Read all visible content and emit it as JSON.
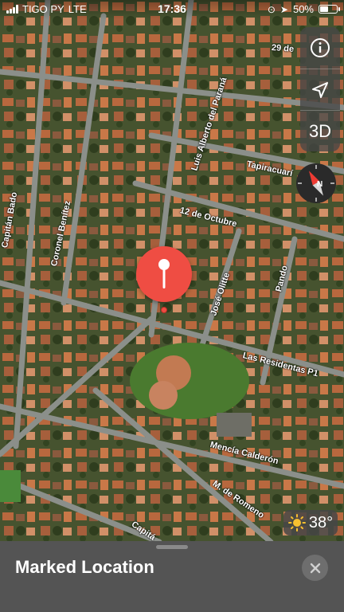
{
  "status_bar": {
    "carrier": "TIGO PY",
    "network": "LTE",
    "time": "17:36",
    "battery": "50%",
    "battery_level": 0.5
  },
  "map_controls": {
    "info_icon": "info-icon",
    "location_icon": "location-arrow-icon",
    "view_3d_label": "3D"
  },
  "streets": {
    "luis_alberto": "Luis Alberto del Paraná",
    "street_29": "29 de",
    "tapiracuai": "Tapiracuarí",
    "capitan_bado": "Capitán Bado",
    "coronel_benitez": "Coronel Benítez",
    "doce_octubre": "12 de Octubre",
    "jose_olitte": "José Olitte",
    "pando": "Pando",
    "residentas": "Las Residentas P1",
    "mencia": "Mencía Calderón",
    "romeno": "M. de Romeno",
    "capita": "Capitá"
  },
  "weather": {
    "icon": "sun-icon",
    "temperature": "38°"
  },
  "sheet": {
    "title": "Marked Location",
    "close_icon": "close-icon"
  },
  "colors": {
    "pin": "#ef4d43",
    "sheet_bg": "#545454",
    "control_bg": "#464646"
  }
}
